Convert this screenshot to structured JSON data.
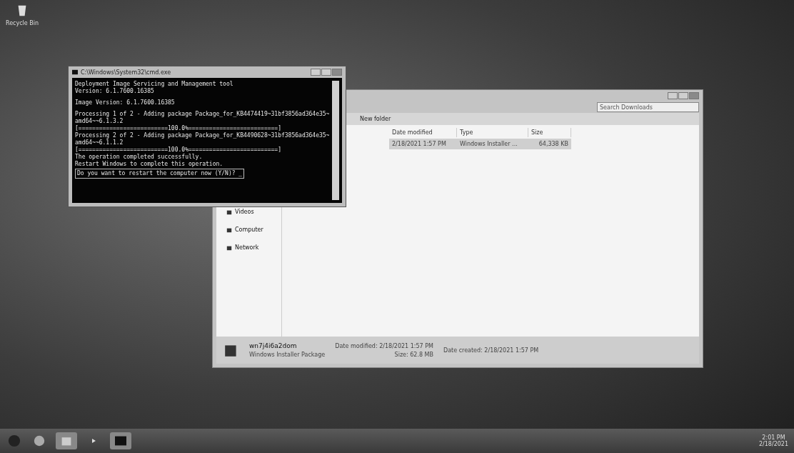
{
  "desktop_icons": [
    {
      "label": "Recycle Bin"
    }
  ],
  "console": {
    "title": "C:\\Windows\\System32\\cmd.exe",
    "lines": [
      "Deployment Image Servicing and Management tool",
      "Version: 6.1.7600.16385",
      "Image Version: 6.1.7600.16385",
      "Processing 1 of 2 - Adding package Package_for_KB4474419~31bf3856ad364e35~amd64~~6.1.3.2",
      "[==========================100.0%==========================]",
      "Processing 2 of 2 - Adding package Package_for_KB4490628~31bf3856ad364e35~amd64~~6.1.1.2",
      "[==========================100.0%==========================]",
      "The operation completed successfully.",
      "Restart Windows to complete this operation."
    ],
    "prompt": "Do you want to restart the computer now (Y/N)? _"
  },
  "explorer": {
    "search": {
      "placeholder": "Search Downloads"
    },
    "toolbar": [
      "New folder"
    ],
    "sidebar": [
      {
        "label": "Videos"
      },
      {
        "label": "Computer"
      },
      {
        "label": "Network"
      }
    ],
    "columns": [
      "Date modified",
      "Type",
      "Size"
    ],
    "rows": [
      {
        "cells": [
          "2/18/2021 1:57 PM",
          "Windows Installer ...",
          "64,338 KB"
        ],
        "selected": true
      }
    ],
    "details": {
      "name": "wn7j4i6a2dom",
      "type": "Windows Installer Package",
      "modified": "Date modified: 2/18/2021 1:57 PM",
      "size": "Size: 62.8 MB",
      "created": "Date created: 2/18/2021 1:57 PM"
    }
  },
  "taskbar": {
    "time": "2:01 PM",
    "date": "2/18/2021"
  }
}
